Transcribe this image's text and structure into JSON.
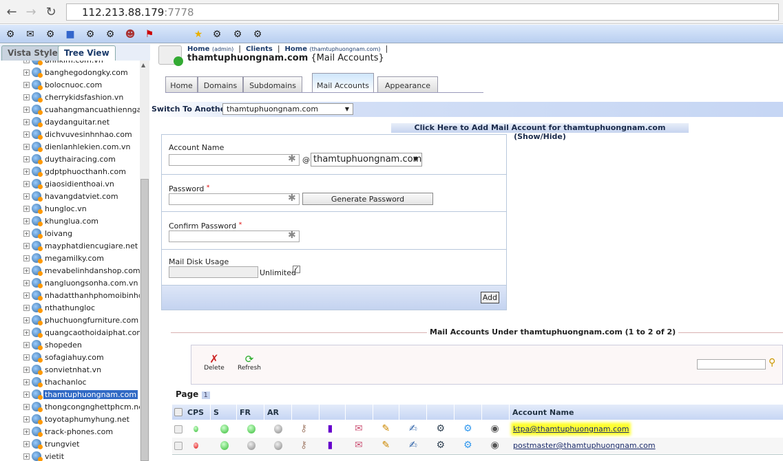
{
  "browser": {
    "url_host": "112.213.88.179",
    "url_port": ":7778"
  },
  "left_panel": {
    "tabs": [
      "Vista Style",
      "Tree View"
    ],
    "active_tab": "Tree View",
    "tree_items": [
      "anhkim.com.vn",
      "banghegodongky.com",
      "bolocnuoc.com",
      "cherrykidsfashion.vn",
      "cuahangmancuathiennga.co",
      "daydanguitar.net",
      "dichvuvesinhnhao.com",
      "dienlanhlekien.com.vn",
      "duythairacing.com",
      "gdptphuocthanh.com",
      "giaosidienthoai.vn",
      "havangdatviet.com",
      "hungloc.vn",
      "khunglua.com",
      "loivang",
      "mayphatdiencugiare.net",
      "megamilky.com",
      "mevabelinhdanshop.com",
      "nangluongsonha.com.vn",
      "nhadatthanhphomoibinhduo",
      "nthathungloc",
      "phuchuongfurniture.com",
      "quangcaothoidaiphat.com",
      "shopeden",
      "sofagiahuy.com",
      "sonvietnhat.vn",
      "thachanloc",
      "thamtuphuongnam.com",
      "thongcongnghettphcm.net",
      "toyotaphumyhung.net",
      "track-phones.com",
      "trungviet",
      "vietit"
    ],
    "selected": "thamtuphuongnam.com"
  },
  "breadcrumb": {
    "home": "Home",
    "home_sub": "(admin)",
    "clients": "Clients",
    "home2": "Home",
    "home2_sub": "(thamtuphuongnam.com)",
    "sep": "|"
  },
  "page": {
    "domain": "thamtuphuongnam.com",
    "section": "{Mail Accounts}"
  },
  "tabs": [
    "Home",
    "Domains",
    "Subdomains",
    "Mail Accounts",
    "Appearance"
  ],
  "active_tab": "Mail Accounts",
  "switch": {
    "label": "Switch To Another",
    "value": "thamtuphuongnam.com"
  },
  "add_link": "Click Here to Add Mail Account for thamtuphuongnam.com (Show/Hide)",
  "form": {
    "account_name": "Account Name",
    "at": "@",
    "domain": "thamtuphuongnam.com",
    "password": "Password",
    "generate": "Generate Password",
    "confirm": "Confirm Password",
    "disk": "Mail Disk Usage",
    "unlimited": "Unlimited",
    "unlimited_checked": true,
    "add": "Add",
    "required": "*"
  },
  "list": {
    "title": "Mail Accounts Under thamtuphuongnam.com (1 to 2 of 2)",
    "delete": "Delete",
    "refresh": "Refresh",
    "page_label": "Page",
    "page": "1",
    "columns": [
      "CPS",
      "S",
      "FR",
      "AR",
      "Account Name"
    ],
    "rows": [
      {
        "account": "ktpa@thamtuphuongnam.com",
        "cps": "green",
        "s": "green",
        "fr": "green",
        "ar": "gray",
        "highlighted": true
      },
      {
        "account": "postmaster@thamtuphuongnam.com",
        "cps": "red",
        "s": "green",
        "fr": "gray",
        "ar": "gray",
        "highlighted": false
      }
    ]
  },
  "colors": {
    "accent": "#316ac5",
    "highlight": "#ffff33",
    "header_blue": "#c8d8f4"
  }
}
